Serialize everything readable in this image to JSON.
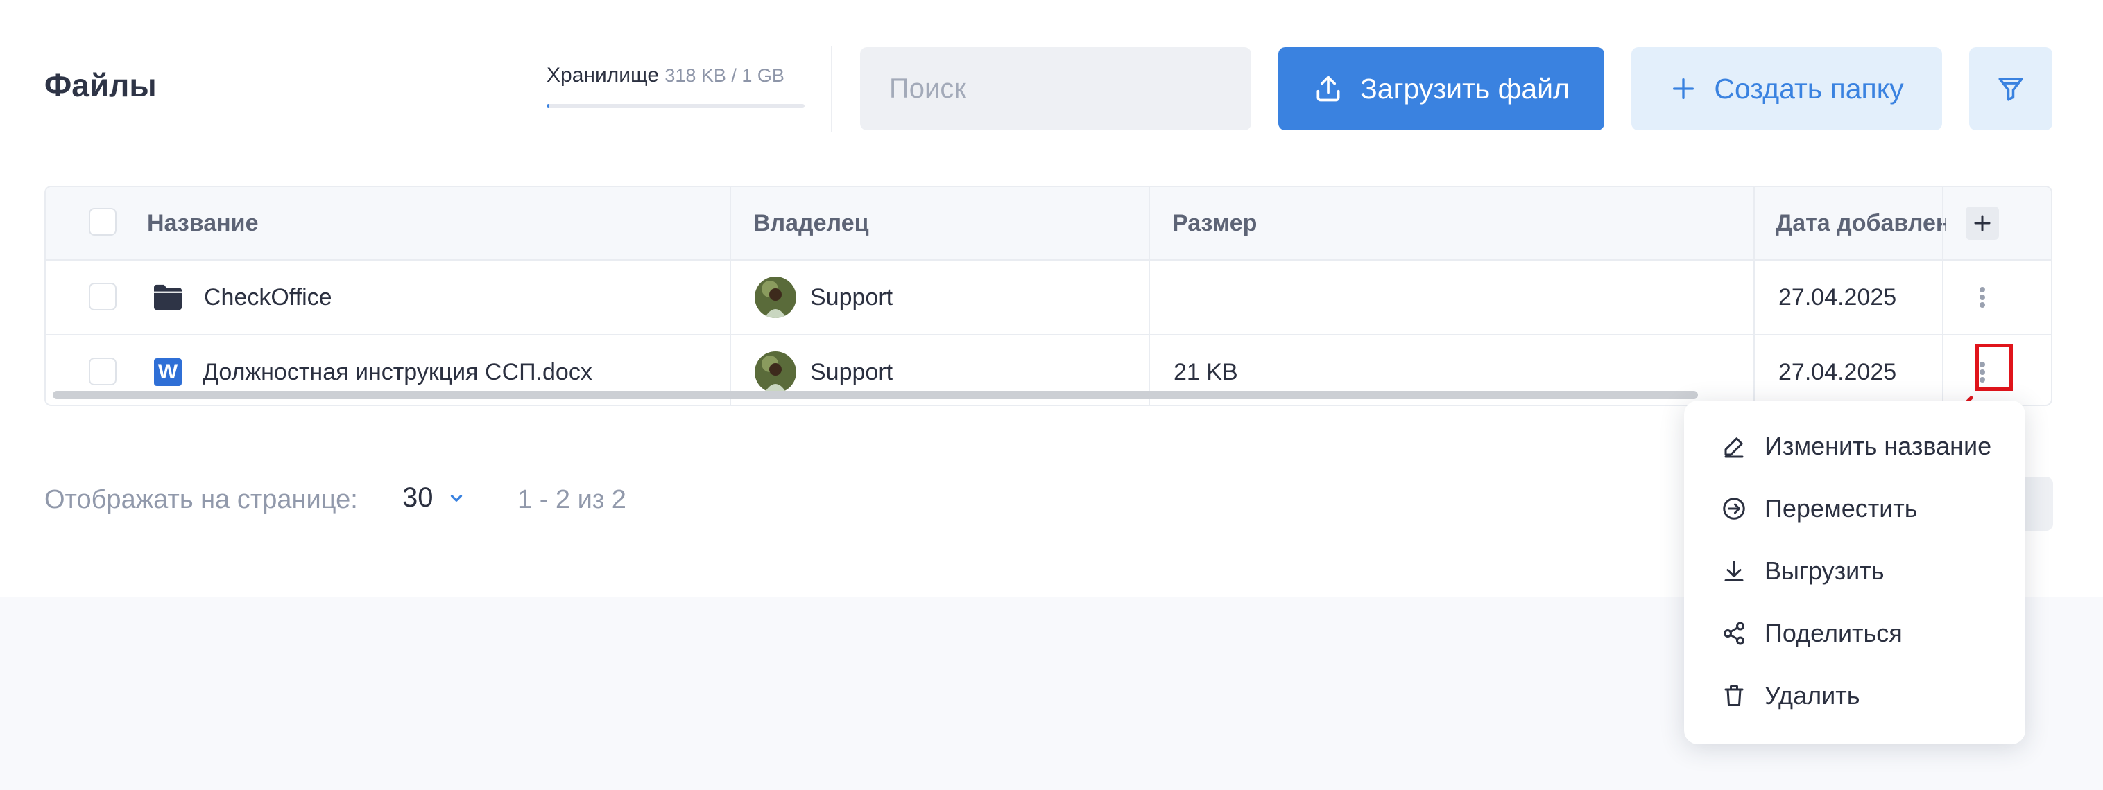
{
  "header": {
    "title": "Файлы",
    "storage": {
      "label": "Хранилище",
      "value": "318 KB / 1 GB",
      "used_fraction": 0.0003
    },
    "search": {
      "placeholder": "Поиск",
      "value": ""
    },
    "upload_label": "Загрузить файл",
    "create_folder_label": "Создать папку"
  },
  "table": {
    "columns": [
      "Название",
      "Владелец",
      "Размер",
      "Дата добавления"
    ],
    "rows": [
      {
        "type": "folder",
        "name": "CheckOffice",
        "owner": "Support",
        "size": "",
        "date": "27.04.2025"
      },
      {
        "type": "docx",
        "file_badge": "W",
        "name": "Должностная инструкция ССП.docx",
        "owner": "Support",
        "size": "21 KB",
        "date": "27.04.2025"
      }
    ]
  },
  "pagination": {
    "per_page_label": "Отображать на странице:",
    "per_page_value": "30",
    "range": "1 - 2 из 2"
  },
  "context_menu": {
    "items": [
      {
        "label": "Изменить название",
        "icon": "edit-icon"
      },
      {
        "label": "Переместить",
        "icon": "move-icon"
      },
      {
        "label": "Выгрузить",
        "icon": "download-icon"
      },
      {
        "label": "Поделиться",
        "icon": "share-icon"
      },
      {
        "label": "Удалить",
        "icon": "trash-icon"
      }
    ]
  },
  "colors": {
    "primary": "#3a82e0",
    "primary_light": "#e3effb",
    "highlight": "#e0141b",
    "text": "#2b3040",
    "muted": "#9199ab",
    "page_bottom": "#f8f9fc"
  }
}
